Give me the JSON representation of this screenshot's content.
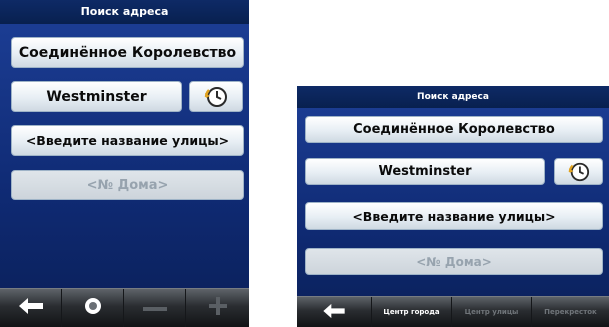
{
  "screens": [
    {
      "title": "Поиск адреса",
      "country": "Соединённое Королевство",
      "city": "Westminster",
      "street_placeholder": "<Введите название улицы>",
      "house_number_placeholder": "<№ Дома>",
      "icons": {
        "history": "clock-history-icon",
        "back": "back-arrow-icon",
        "center": "circle-target-icon",
        "minus": "minus-icon",
        "plus": "plus-icon"
      }
    },
    {
      "title": "Поиск адреса",
      "country": "Соединённое Королевство",
      "city": "Westminster",
      "street_placeholder": "<Введите название улицы>",
      "house_number_placeholder": "<№ Дома>",
      "bottom_bar": {
        "city_center": "Центр города",
        "street_center": "Центр улицы",
        "intersection": "Перекресток"
      },
      "icons": {
        "history": "clock-history-icon",
        "back": "back-arrow-icon"
      }
    }
  ],
  "colors": {
    "screen_background": "#133585",
    "title_bar": "#0b2459",
    "button_face": "#e7eef4",
    "button_disabled_text": "#97a3ae",
    "bottom_bar": "#2a2d31",
    "history_icon_accent": "#e0a321"
  }
}
